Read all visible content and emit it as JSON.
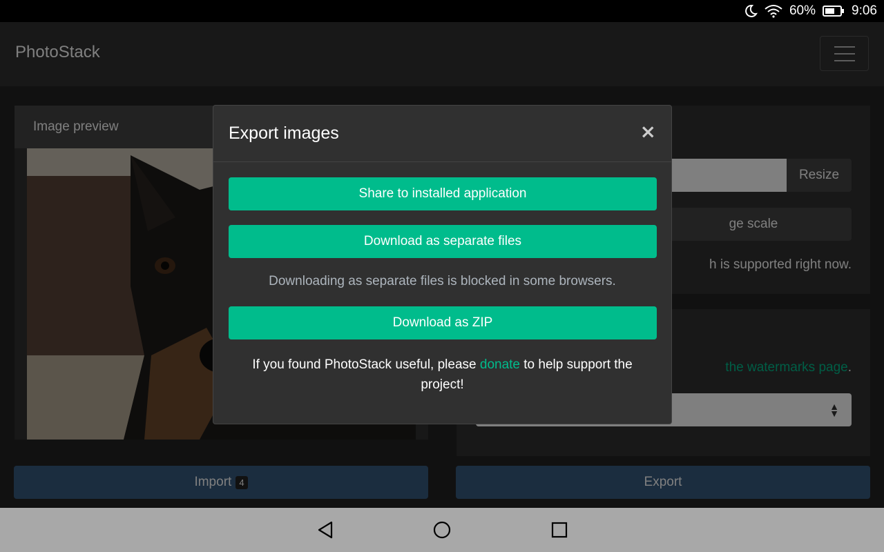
{
  "status_bar": {
    "battery_percent": "60%",
    "time": "9:06",
    "icons": [
      "moon-icon",
      "wifi-icon",
      "battery-icon"
    ]
  },
  "app": {
    "brand": "PhotoStack",
    "menu_icon": "hamburger-icon"
  },
  "left_card": {
    "header": "Image preview"
  },
  "right_card_top": {
    "resize_button": "Resize",
    "scale_button_visible": "ge scale",
    "support_text_visible": "h is supported right now."
  },
  "right_card_bottom": {
    "link_text": "the watermarks page",
    "trailing": "."
  },
  "footer": {
    "import_label": "Import",
    "import_badge": "4",
    "export_label": "Export"
  },
  "modal": {
    "title": "Export images",
    "close_symbol": "×",
    "share_button": "Share to installed application",
    "download_separate_button": "Download as separate files",
    "blocked_note": "Downloading as separate files is blocked in some browsers.",
    "download_zip_button": "Download as ZIP",
    "donate_prefix": "If you found PhotoStack useful, please ",
    "donate_link": "donate",
    "donate_suffix": " to help support the project!"
  },
  "colors": {
    "success": "#00bc8c",
    "primary": "#375a7f",
    "surface": "#303030",
    "background": "#222222"
  },
  "android_nav": {
    "buttons": [
      "back-icon",
      "home-icon",
      "recents-icon"
    ]
  }
}
